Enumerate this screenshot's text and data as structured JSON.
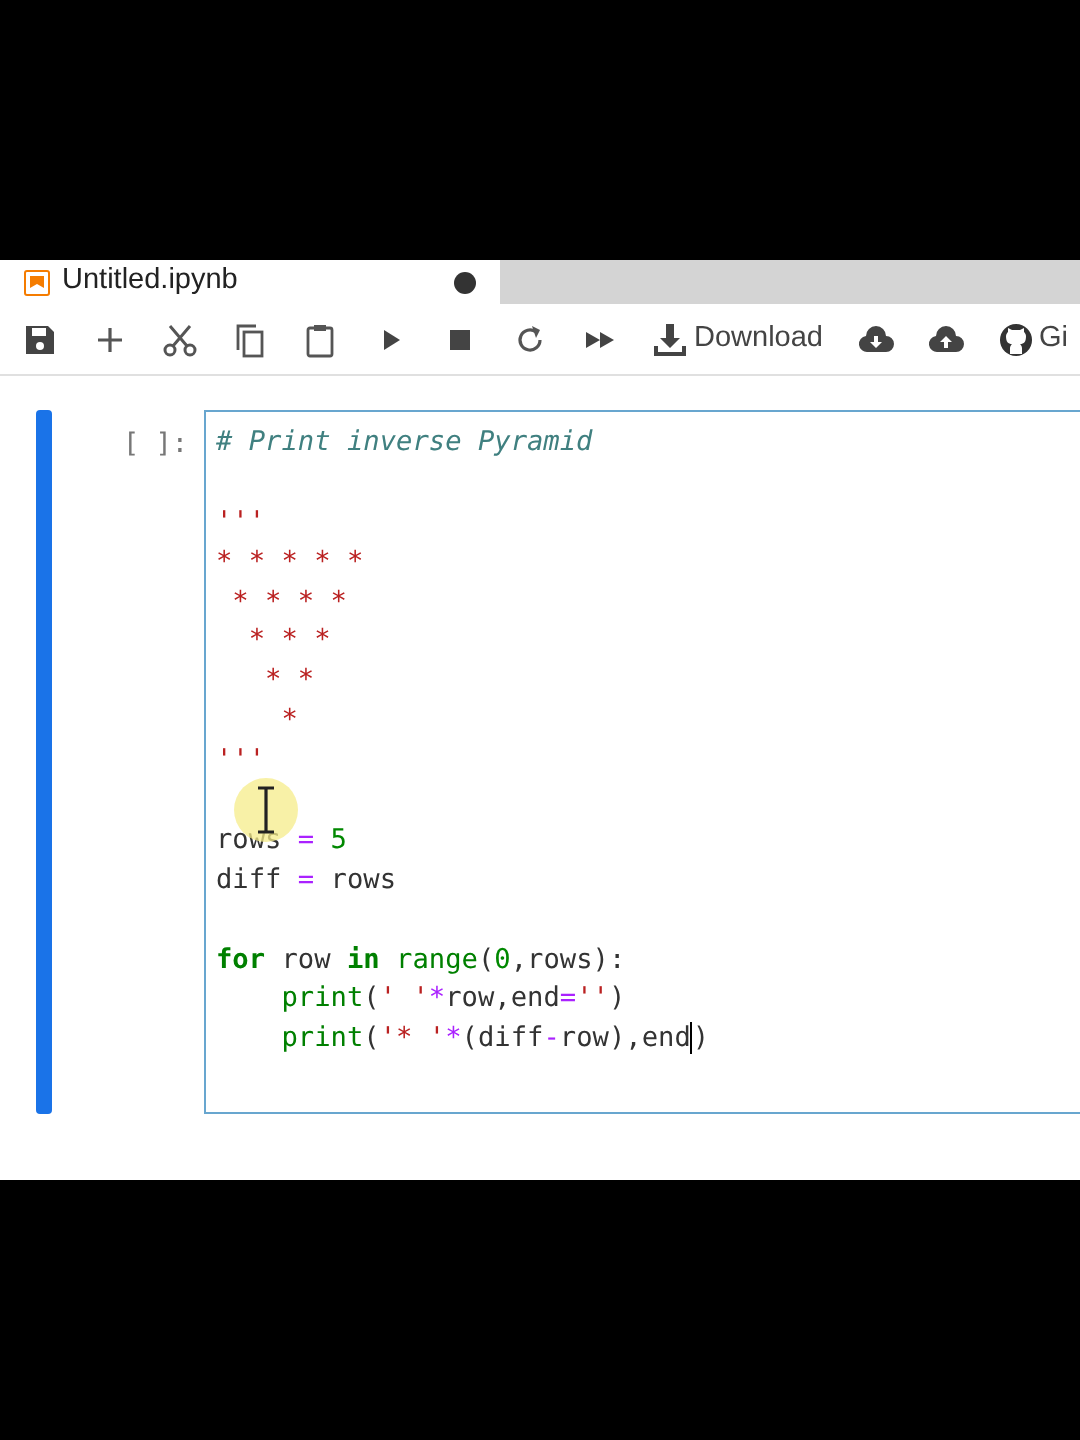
{
  "tab": {
    "title": "Untitled.ipynb",
    "unsaved": true
  },
  "toolbar": [
    {
      "kind": "save"
    },
    {
      "kind": "add"
    },
    {
      "kind": "cut"
    },
    {
      "kind": "copy"
    },
    {
      "kind": "paste"
    },
    {
      "kind": "run"
    },
    {
      "kind": "stop"
    },
    {
      "kind": "restart"
    },
    {
      "kind": "run-all"
    },
    {
      "kind": "download",
      "label": "Download"
    },
    {
      "kind": "cloud-down"
    },
    {
      "kind": "cloud-up"
    },
    {
      "kind": "github",
      "label": "Gi"
    }
  ],
  "cell": {
    "prompt": "[ ]:",
    "selected": true,
    "lines": [
      {
        "tokens": [
          {
            "t": "# Print inverse Pyramid",
            "kind": "comment"
          }
        ]
      },
      {
        "space_before": true,
        "tokens": [
          {
            "t": "'''",
            "kind": "string"
          }
        ]
      },
      {
        "tokens": [
          {
            "t": "* * * * *",
            "kind": "string"
          }
        ]
      },
      {
        "tokens": [
          {
            "t": " * * * *",
            "kind": "string"
          }
        ]
      },
      {
        "tokens": [
          {
            "t": "  * * *",
            "kind": "string"
          }
        ]
      },
      {
        "tokens": [
          {
            "t": "   * *",
            "kind": "string"
          }
        ]
      },
      {
        "tokens": [
          {
            "t": "    *",
            "kind": "string"
          }
        ]
      },
      {
        "tokens": [
          {
            "t": "'''",
            "kind": "string"
          }
        ]
      },
      {
        "space_before": true,
        "tokens": [
          {
            "t": "rows ",
            "kind": "plain"
          },
          {
            "t": "=",
            "kind": "operator"
          },
          {
            "t": " 5",
            "kind": "number"
          }
        ]
      },
      {
        "tokens": [
          {
            "t": "diff ",
            "kind": "plain"
          },
          {
            "t": "=",
            "kind": "operator"
          },
          {
            "t": " rows",
            "kind": "plain"
          }
        ]
      },
      {
        "space_before": true,
        "tokens": [
          {
            "t": "for",
            "kind": "keyword"
          },
          {
            "t": " row ",
            "kind": "plain"
          },
          {
            "t": "in",
            "kind": "keyword"
          },
          {
            "t": " range",
            "kind": "builtin"
          },
          {
            "t": "(",
            "kind": "plain"
          },
          {
            "t": "0",
            "kind": "number"
          },
          {
            "t": ",rows):",
            "kind": "plain"
          }
        ]
      },
      {
        "tokens": [
          {
            "t": "    print",
            "kind": "builtin"
          },
          {
            "t": "(",
            "kind": "plain"
          },
          {
            "t": "' '",
            "kind": "string"
          },
          {
            "t": "*",
            "kind": "operator"
          },
          {
            "t": "row,end",
            "kind": "plain"
          },
          {
            "t": "=",
            "kind": "operator"
          },
          {
            "t": "''",
            "kind": "string"
          },
          {
            "t": ")",
            "kind": "plain"
          }
        ]
      },
      {
        "tokens": [
          {
            "t": "    print",
            "kind": "builtin"
          },
          {
            "t": "(",
            "kind": "plain"
          },
          {
            "t": "'* '",
            "kind": "string"
          },
          {
            "t": "*",
            "kind": "operator"
          },
          {
            "t": "(diff",
            "kind": "plain"
          },
          {
            "t": "-",
            "kind": "operator"
          },
          {
            "t": "row),end",
            "kind": "plain",
            "cursor_after": true
          },
          {
            "t": ")",
            "kind": "plain"
          }
        ]
      }
    ]
  }
}
